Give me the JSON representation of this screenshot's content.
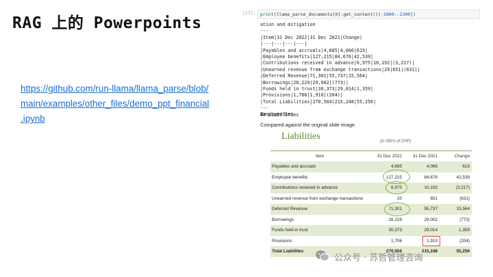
{
  "slide": {
    "title": "RAG 上的 Powerpoints",
    "link_lines": [
      "https://github.com/run-llama/llama_parse/blob/",
      "main/examples/other_files/demo_ppt_financial",
      ".ipynb"
    ]
  },
  "notebook": {
    "prompt": "[27]:",
    "code": {
      "fn": "print",
      "call": "(llama_parse_documents[",
      "index": "0",
      "mid": "].get_content()[",
      "slice": "-2800:-2300",
      "end": "])"
    },
    "output_lines": [
      "ation and mitigation",
      "---",
      "|Item|31 Dec 2022|31 Dec 2021|Change|",
      "|---|---|---|---|",
      "|Payables and accruals|4,685|4,066|619|",
      "|Employee benefits|127,215|84,676|42,539|",
      "|Contributions received in advance|6,975|10,192|(3,217)|",
      "|Unearned revenue from exchange transactions|20|651|(631)|",
      "|Deferred Revenue|71,301|55,737|15,564|",
      "|Borrowings|28,229|29,002|(773)|",
      "|Funds held in trust|30,373|29,014|1,359|",
      "|Provisions|1,706|1,910|(204)|",
      "|Total Liabilities|270,504|215,248|55,256|",
      "---",
      "## Liabilities"
    ],
    "text1": "Employee Ben",
    "text2": "Compared against the original slide image."
  },
  "image": {
    "title": "Liabilities",
    "unit": "(in 000's of CHF)",
    "headers": [
      "Item",
      "31 Dec 2022",
      "31 Dec 2021",
      "Change"
    ],
    "rows": [
      {
        "item": "Payables and accruals",
        "v1": "4,685",
        "v2": "4,066",
        "v3": "619"
      },
      {
        "item": "Employee benefits",
        "v1": "127,215",
        "v2": "84,676",
        "v3": "42,539"
      },
      {
        "item": "Contributions received in advance",
        "v1": "6,975",
        "v2": "10,192",
        "v3": "(3,217)"
      },
      {
        "item": "Unearned revenue from exchange transactions",
        "v1": "20",
        "v2": "651",
        "v3": "(631)"
      },
      {
        "item": "Deferred Revenue",
        "v1": "71,301",
        "v2": "55,737",
        "v3": "15,564"
      },
      {
        "item": "Borrowings",
        "v1": "28,229",
        "v2": "29,002",
        "v3": "(773)"
      },
      {
        "item": "Funds held in trust",
        "v1": "30,373",
        "v2": "29,014",
        "v3": "1,359"
      },
      {
        "item": "Provisions",
        "v1": "1,706",
        "v2": "1,910",
        "v3": "(204)"
      },
      {
        "item": "Total Liabilities",
        "v1": "270,504",
        "v2": "215,248",
        "v3": "55,256"
      }
    ]
  },
  "watermark": {
    "text": "公众号 · 苏哲管理咨询",
    "icon": "wechat-icon"
  },
  "colors": {
    "link": "#1a6fd0",
    "accent_green": "#5a8a2a",
    "row_shade": "#e3ebd2",
    "highlight_red": "#e04b3c"
  }
}
